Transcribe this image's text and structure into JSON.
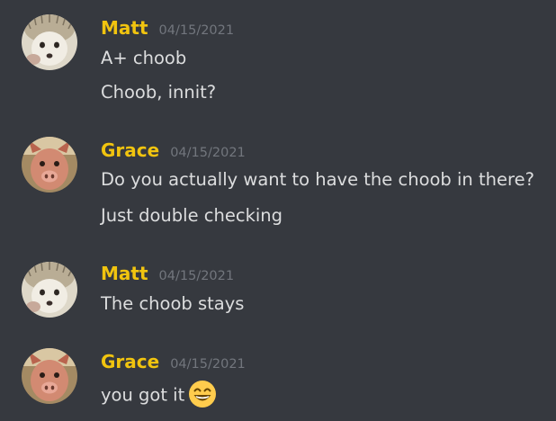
{
  "messages": [
    {
      "author": "Matt",
      "timestamp": "04/15/2021",
      "lines": [
        "A+ choob",
        "Choob, innit?"
      ]
    },
    {
      "author": "Grace",
      "timestamp": "04/15/2021",
      "lines": [
        "Do you actually want to have the choob in there?",
        "Just double checking"
      ]
    },
    {
      "author": "Matt",
      "timestamp": "04/15/2021",
      "lines": [
        "The choob stays"
      ]
    },
    {
      "author": "Grace",
      "timestamp": "04/15/2021",
      "lines": [
        "you got it"
      ],
      "emoji": "grinning-smile-emoji"
    }
  ],
  "colors": {
    "background": "#36393f",
    "username": "#f1c40f",
    "timestamp": "#72767d",
    "message_text": "#dcddde"
  },
  "icons": {
    "matt_avatar": "hedgehog-avatar",
    "grace_avatar": "pig-avatar"
  }
}
